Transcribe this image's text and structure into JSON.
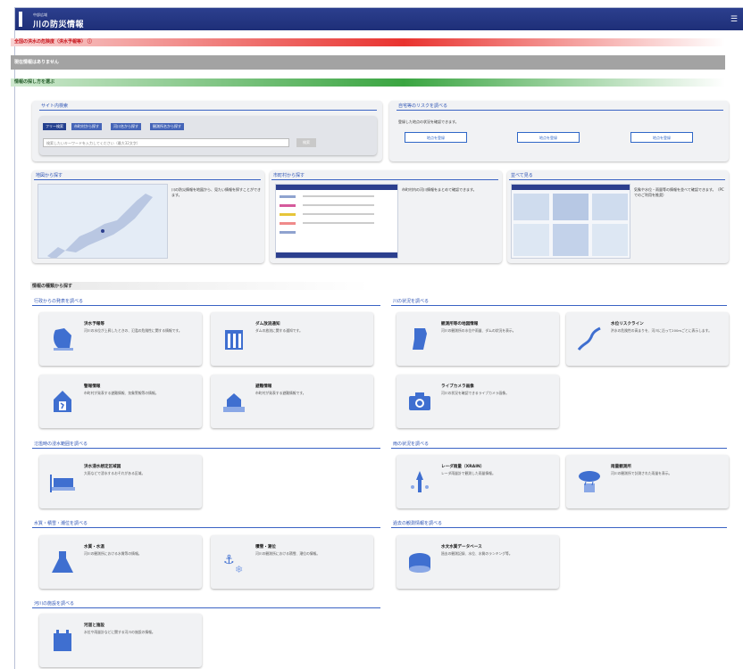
{
  "header": {
    "org": "中部広域",
    "title": "川の防災情報",
    "menu_icon": "menu-icon"
  },
  "alerts": {
    "danger_title": "全国の洪水の危険度（洪水予報等）",
    "danger_info_icon": "info-icon",
    "status_text": "現在情報はありません",
    "how_to_title": "情報の探し方を選ぶ"
  },
  "site_search": {
    "title": "サイト内検索",
    "tabs": [
      "フリー検索",
      "市町村から探す",
      "河川名から探す",
      "観測所名から探す"
    ],
    "placeholder": "検索したいキーワードを入力してください（最大32文字）",
    "button": "検索"
  },
  "risk": {
    "title": "自宅等のリスクを調べる",
    "desc": "登録した地点の状況を確認できます。",
    "buttons": [
      "地点を登録",
      "地点を登録",
      "地点を登録"
    ]
  },
  "find_map": {
    "title": "地図から探す",
    "desc": "川の防災情報を地図から、見たい情報を探すことができます。"
  },
  "find_city": {
    "title": "市町村から探す",
    "desc": "市町村内の河川情報をまとめて確認できます。"
  },
  "find_all": {
    "title": "並べて見る",
    "desc": "気象や水位・雨量等の情報を並べて確認できます。（PCでのご利用を推奨）"
  },
  "by_type_title": "情報の種類から探す",
  "sections": {
    "gov": "行政からの発表を調べる",
    "river": "川の状況を調べる",
    "flood_area": "氾濫時の浸水範囲を調べる",
    "rain": "雨の状況を調べる",
    "quality": "水質・積雪・潮位を調べる",
    "history": "過去の観測情報を調べる",
    "facility": "河川の施設を調べる"
  },
  "cards": {
    "flood_forecast": {
      "title": "洪水予報等",
      "desc": "河川の水位が上昇したときの、氾濫の危険性に関する情報です。",
      "icon": "flood-forecast-icon"
    },
    "dam": {
      "title": "ダム放流通知",
      "desc": "ダムの放流に関する通知です。",
      "icon": "dam-release-icon"
    },
    "warning": {
      "title": "警報情報",
      "desc": "市町村が発表する避難情報、気象警報等の情報。",
      "icon": "evacuation-icon"
    },
    "evac": {
      "title": "避難情報",
      "desc": "市町村が発表する避難情報です。",
      "icon": "house-flood-icon"
    },
    "obs": {
      "title": "観測所等の地図情報",
      "desc": "河川の観測所の水位や雨量、ダムの状況を表示。",
      "icon": "map-hand-icon"
    },
    "waterline": {
      "title": "水位リスクライン",
      "desc": "洪水の危険性の高まりを、河川に沿って200mごとに表示します。",
      "icon": "risk-line-icon"
    },
    "camera": {
      "title": "ライブカメラ画像",
      "desc": "河川の状況を確認できるライブカメラ画像。",
      "icon": "camera-icon"
    },
    "inundation": {
      "title": "洪水浸水想定区域図",
      "desc": "大雨などで浸水するおそれがある区域。",
      "icon": "inundation-icon"
    },
    "radar": {
      "title": "レーダ雨量（XRAIN）",
      "desc": "レーダ雨量計で観測した雨量情報。",
      "icon": "radar-icon"
    },
    "rain_obs": {
      "title": "雨量観測所",
      "desc": "河川の観測所で計測された雨量を表示。",
      "icon": "rain-gauge-icon"
    },
    "quality": {
      "title": "水質・水温",
      "desc": "河川の観測所における水質等の情報。",
      "icon": "flask-icon"
    },
    "snow": {
      "title": "積雪・潮位",
      "desc": "河川の観測所における積雪、潮位の情報。",
      "icon": "snow-tide-icon"
    },
    "database": {
      "title": "水文水質データベース",
      "desc": "過去の観測記録、水位、水質のランキング等。",
      "icon": "database-icon"
    },
    "facility": {
      "title": "河道と施設",
      "desc": "水位や雨量計などに関する河川の施設の情報。",
      "icon": "river-facility-icon"
    }
  },
  "colors": {
    "header": "#24367f",
    "accent_blue": "#2f67c7",
    "danger_red": "#e9332f",
    "guide_green": "#3aa541",
    "status_gray": "#a3a3a3"
  }
}
